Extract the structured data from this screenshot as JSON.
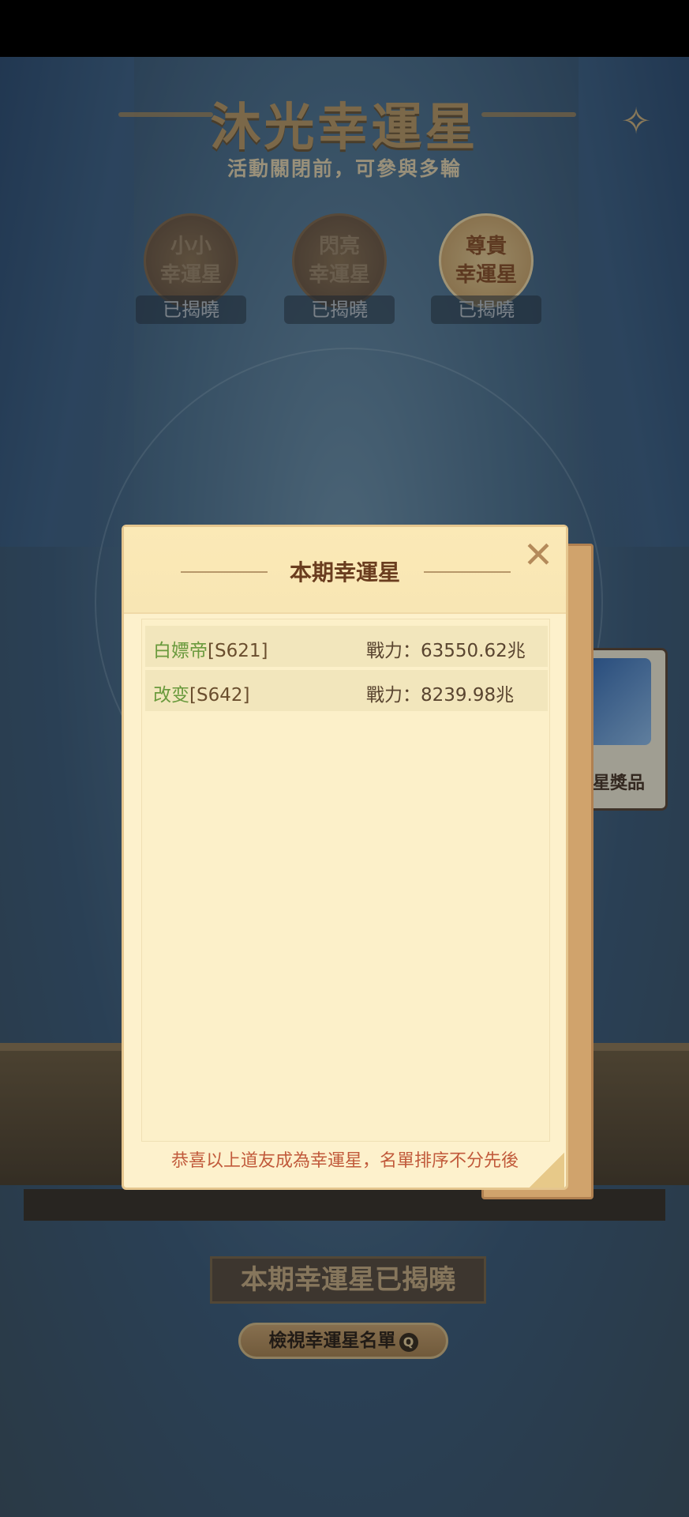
{
  "event": {
    "title": "沐光幸運星",
    "subtitle": "活動關閉前，可參與多輪"
  },
  "tiers": [
    {
      "name": "小小\n幸運星",
      "status": "已揭曉"
    },
    {
      "name": "閃亮\n幸運星",
      "status": "已揭曉"
    },
    {
      "name": "尊貴\n幸運星",
      "status": "已揭曉"
    }
  ],
  "reward": {
    "label": "運星獎品"
  },
  "announce": "本期幸運星已揭曉",
  "view_button": "檢視幸運星名單",
  "dialog": {
    "title": "本期幸運星",
    "rows": [
      {
        "name": "白嫖帝",
        "server": "[S621]",
        "power": "戰力：63550.62兆"
      },
      {
        "name": "改变",
        "server": "[S642]",
        "power": "戰力：8239.98兆"
      }
    ],
    "footer": "恭喜以上道友成為幸運星，名單排序不分先後"
  },
  "colors": {
    "accent_gold": "#b89561",
    "dialog_bg": "#fdf1cc",
    "name_green": "#6a9a3d",
    "note_red": "#c15a3b"
  }
}
